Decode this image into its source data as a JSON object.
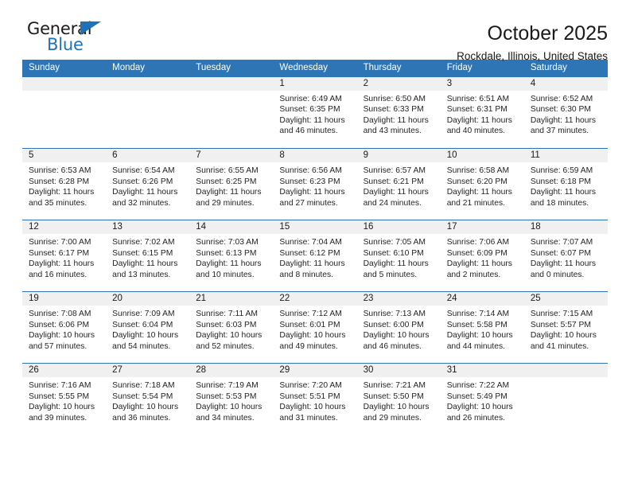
{
  "brand": {
    "name_top": "General",
    "name_bottom": "Blue",
    "triangle_icon": "triangle-icon",
    "accent_color": "#1f72b8"
  },
  "header": {
    "title": "October 2025",
    "subtitle": "Rockdale, Illinois, United States"
  },
  "theme": {
    "header_blue": "#2e75b6",
    "daynum_gray": "#f0f0f0",
    "text": "#1a1a1a"
  },
  "labels": {
    "sunrise": "Sunrise:",
    "sunset": "Sunset:",
    "daylight": "Daylight:"
  },
  "weekdays": [
    "Sunday",
    "Monday",
    "Tuesday",
    "Wednesday",
    "Thursday",
    "Friday",
    "Saturday"
  ],
  "weeks": [
    [
      {
        "day": "",
        "sunrise": "",
        "sunset": "",
        "daylight": ""
      },
      {
        "day": "",
        "sunrise": "",
        "sunset": "",
        "daylight": ""
      },
      {
        "day": "",
        "sunrise": "",
        "sunset": "",
        "daylight": ""
      },
      {
        "day": "1",
        "sunrise": "Sunrise: 6:49 AM",
        "sunset": "Sunset: 6:35 PM",
        "daylight": "Daylight: 11 hours and 46 minutes."
      },
      {
        "day": "2",
        "sunrise": "Sunrise: 6:50 AM",
        "sunset": "Sunset: 6:33 PM",
        "daylight": "Daylight: 11 hours and 43 minutes."
      },
      {
        "day": "3",
        "sunrise": "Sunrise: 6:51 AM",
        "sunset": "Sunset: 6:31 PM",
        "daylight": "Daylight: 11 hours and 40 minutes."
      },
      {
        "day": "4",
        "sunrise": "Sunrise: 6:52 AM",
        "sunset": "Sunset: 6:30 PM",
        "daylight": "Daylight: 11 hours and 37 minutes."
      }
    ],
    [
      {
        "day": "5",
        "sunrise": "Sunrise: 6:53 AM",
        "sunset": "Sunset: 6:28 PM",
        "daylight": "Daylight: 11 hours and 35 minutes."
      },
      {
        "day": "6",
        "sunrise": "Sunrise: 6:54 AM",
        "sunset": "Sunset: 6:26 PM",
        "daylight": "Daylight: 11 hours and 32 minutes."
      },
      {
        "day": "7",
        "sunrise": "Sunrise: 6:55 AM",
        "sunset": "Sunset: 6:25 PM",
        "daylight": "Daylight: 11 hours and 29 minutes."
      },
      {
        "day": "8",
        "sunrise": "Sunrise: 6:56 AM",
        "sunset": "Sunset: 6:23 PM",
        "daylight": "Daylight: 11 hours and 27 minutes."
      },
      {
        "day": "9",
        "sunrise": "Sunrise: 6:57 AM",
        "sunset": "Sunset: 6:21 PM",
        "daylight": "Daylight: 11 hours and 24 minutes."
      },
      {
        "day": "10",
        "sunrise": "Sunrise: 6:58 AM",
        "sunset": "Sunset: 6:20 PM",
        "daylight": "Daylight: 11 hours and 21 minutes."
      },
      {
        "day": "11",
        "sunrise": "Sunrise: 6:59 AM",
        "sunset": "Sunset: 6:18 PM",
        "daylight": "Daylight: 11 hours and 18 minutes."
      }
    ],
    [
      {
        "day": "12",
        "sunrise": "Sunrise: 7:00 AM",
        "sunset": "Sunset: 6:17 PM",
        "daylight": "Daylight: 11 hours and 16 minutes."
      },
      {
        "day": "13",
        "sunrise": "Sunrise: 7:02 AM",
        "sunset": "Sunset: 6:15 PM",
        "daylight": "Daylight: 11 hours and 13 minutes."
      },
      {
        "day": "14",
        "sunrise": "Sunrise: 7:03 AM",
        "sunset": "Sunset: 6:13 PM",
        "daylight": "Daylight: 11 hours and 10 minutes."
      },
      {
        "day": "15",
        "sunrise": "Sunrise: 7:04 AM",
        "sunset": "Sunset: 6:12 PM",
        "daylight": "Daylight: 11 hours and 8 minutes."
      },
      {
        "day": "16",
        "sunrise": "Sunrise: 7:05 AM",
        "sunset": "Sunset: 6:10 PM",
        "daylight": "Daylight: 11 hours and 5 minutes."
      },
      {
        "day": "17",
        "sunrise": "Sunrise: 7:06 AM",
        "sunset": "Sunset: 6:09 PM",
        "daylight": "Daylight: 11 hours and 2 minutes."
      },
      {
        "day": "18",
        "sunrise": "Sunrise: 7:07 AM",
        "sunset": "Sunset: 6:07 PM",
        "daylight": "Daylight: 11 hours and 0 minutes."
      }
    ],
    [
      {
        "day": "19",
        "sunrise": "Sunrise: 7:08 AM",
        "sunset": "Sunset: 6:06 PM",
        "daylight": "Daylight: 10 hours and 57 minutes."
      },
      {
        "day": "20",
        "sunrise": "Sunrise: 7:09 AM",
        "sunset": "Sunset: 6:04 PM",
        "daylight": "Daylight: 10 hours and 54 minutes."
      },
      {
        "day": "21",
        "sunrise": "Sunrise: 7:11 AM",
        "sunset": "Sunset: 6:03 PM",
        "daylight": "Daylight: 10 hours and 52 minutes."
      },
      {
        "day": "22",
        "sunrise": "Sunrise: 7:12 AM",
        "sunset": "Sunset: 6:01 PM",
        "daylight": "Daylight: 10 hours and 49 minutes."
      },
      {
        "day": "23",
        "sunrise": "Sunrise: 7:13 AM",
        "sunset": "Sunset: 6:00 PM",
        "daylight": "Daylight: 10 hours and 46 minutes."
      },
      {
        "day": "24",
        "sunrise": "Sunrise: 7:14 AM",
        "sunset": "Sunset: 5:58 PM",
        "daylight": "Daylight: 10 hours and 44 minutes."
      },
      {
        "day": "25",
        "sunrise": "Sunrise: 7:15 AM",
        "sunset": "Sunset: 5:57 PM",
        "daylight": "Daylight: 10 hours and 41 minutes."
      }
    ],
    [
      {
        "day": "26",
        "sunrise": "Sunrise: 7:16 AM",
        "sunset": "Sunset: 5:55 PM",
        "daylight": "Daylight: 10 hours and 39 minutes."
      },
      {
        "day": "27",
        "sunrise": "Sunrise: 7:18 AM",
        "sunset": "Sunset: 5:54 PM",
        "daylight": "Daylight: 10 hours and 36 minutes."
      },
      {
        "day": "28",
        "sunrise": "Sunrise: 7:19 AM",
        "sunset": "Sunset: 5:53 PM",
        "daylight": "Daylight: 10 hours and 34 minutes."
      },
      {
        "day": "29",
        "sunrise": "Sunrise: 7:20 AM",
        "sunset": "Sunset: 5:51 PM",
        "daylight": "Daylight: 10 hours and 31 minutes."
      },
      {
        "day": "30",
        "sunrise": "Sunrise: 7:21 AM",
        "sunset": "Sunset: 5:50 PM",
        "daylight": "Daylight: 10 hours and 29 minutes."
      },
      {
        "day": "31",
        "sunrise": "Sunrise: 7:22 AM",
        "sunset": "Sunset: 5:49 PM",
        "daylight": "Daylight: 10 hours and 26 minutes."
      },
      {
        "day": "",
        "sunrise": "",
        "sunset": "",
        "daylight": ""
      }
    ]
  ]
}
